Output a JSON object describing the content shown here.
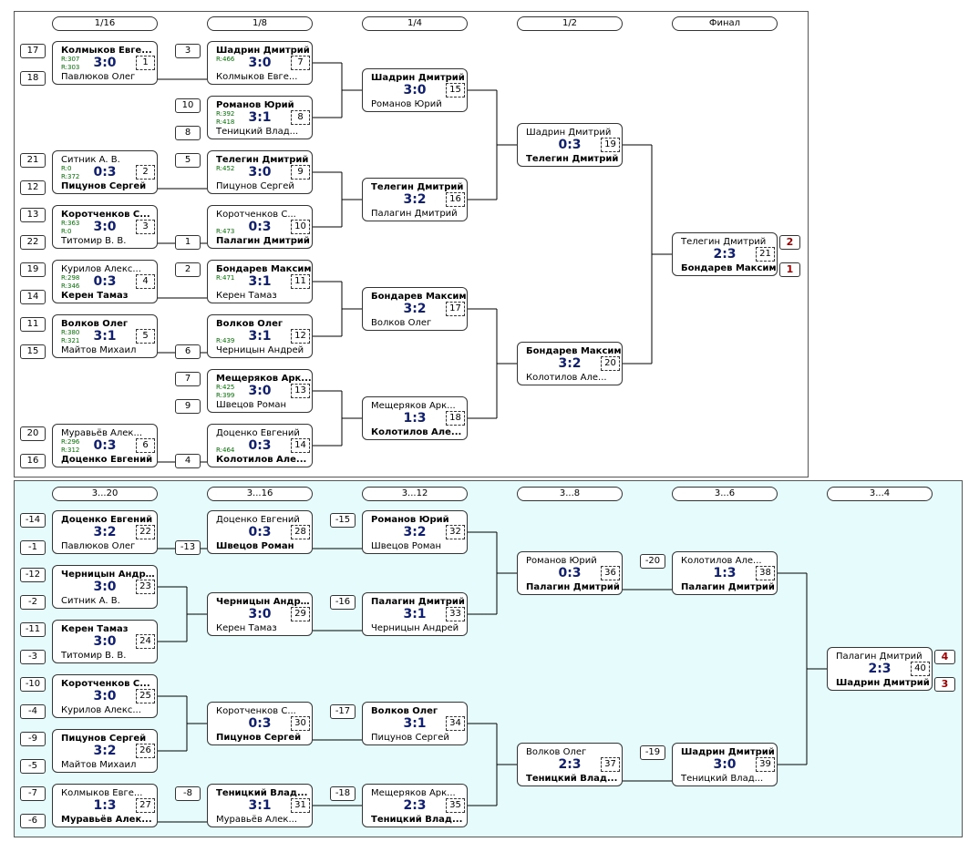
{
  "main": {
    "rounds": [
      "1/16",
      "1/8",
      "1/4",
      "1/2",
      "Финал"
    ],
    "matches": [
      {
        "id": "m1",
        "top": "Колмыков Евге...",
        "bot": "Павлюков Олег",
        "score": "3:0",
        "num": "1",
        "win": "top",
        "r1": "R:307",
        "r2": "R:303"
      },
      {
        "id": "m2",
        "top": "Ситник А. В.",
        "bot": "Пицунов Сергей",
        "score": "0:3",
        "num": "2",
        "win": "bot",
        "r1": "R:0",
        "r2": "R:372"
      },
      {
        "id": "m3",
        "top": "Коротченков С...",
        "bot": "Титомир В. В.",
        "score": "3:0",
        "num": "3",
        "win": "top",
        "r1": "R:363",
        "r2": "R:0"
      },
      {
        "id": "m4",
        "top": "Курилов Алекс...",
        "bot": "Керен Тамаз",
        "score": "0:3",
        "num": "4",
        "win": "bot",
        "r1": "R:298",
        "r2": "R:346"
      },
      {
        "id": "m5",
        "top": "Волков Олег",
        "bot": "Майтов Михаил",
        "score": "3:1",
        "num": "5",
        "win": "top",
        "r1": "R:380",
        "r2": "R:321"
      },
      {
        "id": "m6",
        "top": "Муравьёв Алек...",
        "bot": "Доценко Евгений",
        "score": "0:3",
        "num": "6",
        "win": "bot",
        "r1": "R:296",
        "r2": "R:312"
      },
      {
        "id": "m7",
        "top": "Шадрин Дмитрий",
        "bot": "Колмыков Евге...",
        "score": "3:0",
        "num": "7",
        "win": "top",
        "r1": "R:466",
        "r2": ""
      },
      {
        "id": "m8",
        "top": "Романов Юрий",
        "bot": "Теницкий Влад...",
        "score": "3:1",
        "num": "8",
        "win": "top",
        "r1": "R:392",
        "r2": "R:418"
      },
      {
        "id": "m9",
        "top": "Телегин Дмитрий",
        "bot": "Пицунов Сергей",
        "score": "3:0",
        "num": "9",
        "win": "top",
        "r1": "R:452",
        "r2": ""
      },
      {
        "id": "m10",
        "top": "Коротченков С...",
        "bot": "Палагин Дмитрий",
        "score": "0:3",
        "num": "10",
        "win": "bot",
        "r1": "",
        "r2": "R:473"
      },
      {
        "id": "m11",
        "top": "Бондарев Максим",
        "bot": "Керен Тамаз",
        "score": "3:1",
        "num": "11",
        "win": "top",
        "r1": "R:471",
        "r2": ""
      },
      {
        "id": "m12",
        "top": "Волков Олег",
        "bot": "Черницын Андрей",
        "score": "3:1",
        "num": "12",
        "win": "top",
        "r1": "",
        "r2": "R:439"
      },
      {
        "id": "m13",
        "top": "Мещеряков Арк...",
        "bot": "Швецов Роман",
        "score": "3:0",
        "num": "13",
        "win": "top",
        "r1": "R:425",
        "r2": "R:399"
      },
      {
        "id": "m14",
        "top": "Доценко Евгений",
        "bot": "Колотилов Але...",
        "score": "0:3",
        "num": "14",
        "win": "bot",
        "r1": "",
        "r2": "R:464"
      },
      {
        "id": "m15",
        "top": "Шадрин Дмитрий",
        "bot": "Романов Юрий",
        "score": "3:0",
        "num": "15",
        "win": "top",
        "r1": "",
        "r2": ""
      },
      {
        "id": "m16",
        "top": "Телегин Дмитрий",
        "bot": "Палагин Дмитрий",
        "score": "3:2",
        "num": "16",
        "win": "top",
        "r1": "",
        "r2": ""
      },
      {
        "id": "m17",
        "top": "Бондарев Максим",
        "bot": "Волков Олег",
        "score": "3:2",
        "num": "17",
        "win": "top",
        "r1": "",
        "r2": ""
      },
      {
        "id": "m18",
        "top": "Мещеряков Арк...",
        "bot": "Колотилов Але...",
        "score": "1:3",
        "num": "18",
        "win": "bot",
        "r1": "",
        "r2": ""
      },
      {
        "id": "m19",
        "top": "Шадрин Дмитрий",
        "bot": "Телегин Дмитрий",
        "score": "0:3",
        "num": "19",
        "win": "bot",
        "r1": "",
        "r2": ""
      },
      {
        "id": "m20",
        "top": "Бондарев Максим",
        "bot": "Колотилов Але...",
        "score": "3:2",
        "num": "20",
        "win": "top",
        "r1": "",
        "r2": ""
      },
      {
        "id": "m21",
        "top": "Телегин Дмитрий",
        "bot": "Бондарев Максим",
        "score": "2:3",
        "num": "21",
        "win": "bot",
        "r1": "",
        "r2": ""
      }
    ],
    "seeds": [
      "17",
      "18",
      "21",
      "12",
      "13",
      "22",
      "19",
      "14",
      "11",
      "15",
      "20",
      "16",
      "3",
      "10",
      "8",
      "5",
      "1",
      "2",
      "6",
      "7",
      "9",
      "4"
    ],
    "places": [
      "2",
      "1"
    ]
  },
  "consolation": {
    "rounds": [
      "3...20",
      "3...16",
      "3...12",
      "3...8",
      "3...6",
      "3...4"
    ],
    "matches": [
      {
        "id": "c22",
        "top": "Доценко Евгений",
        "bot": "Павлюков Олег",
        "score": "3:2",
        "num": "22",
        "win": "top"
      },
      {
        "id": "c23",
        "top": "Черницын Андрей",
        "bot": "Ситник А. В.",
        "score": "3:0",
        "num": "23",
        "win": "top"
      },
      {
        "id": "c24",
        "top": "Керен Тамаз",
        "bot": "Титомир В. В.",
        "score": "3:0",
        "num": "24",
        "win": "top"
      },
      {
        "id": "c25",
        "top": "Коротченков С...",
        "bot": "Курилов Алекс...",
        "score": "3:0",
        "num": "25",
        "win": "top"
      },
      {
        "id": "c26",
        "top": "Пицунов Сергей",
        "bot": "Майтов Михаил",
        "score": "3:2",
        "num": "26",
        "win": "top"
      },
      {
        "id": "c27",
        "top": "Колмыков Евге...",
        "bot": "Муравьёв Алек...",
        "score": "1:3",
        "num": "27",
        "win": "bot"
      },
      {
        "id": "c28",
        "top": "Доценко Евгений",
        "bot": "Швецов Роман",
        "score": "0:3",
        "num": "28",
        "win": "bot"
      },
      {
        "id": "c29",
        "top": "Черницын Андрей",
        "bot": "Керен Тамаз",
        "score": "3:0",
        "num": "29",
        "win": "top"
      },
      {
        "id": "c30",
        "top": "Коротченков С...",
        "bot": "Пицунов Сергей",
        "score": "0:3",
        "num": "30",
        "win": "bot"
      },
      {
        "id": "c31",
        "top": "Теницкий Влад...",
        "bot": "Муравьёв Алек...",
        "score": "3:1",
        "num": "31",
        "win": "top"
      },
      {
        "id": "c32",
        "top": "Романов Юрий",
        "bot": "Швецов Роман",
        "score": "3:2",
        "num": "32",
        "win": "top"
      },
      {
        "id": "c33",
        "top": "Палагин Дмитрий",
        "bot": "Черницын Андрей",
        "score": "3:1",
        "num": "33",
        "win": "top"
      },
      {
        "id": "c34",
        "top": "Волков Олег",
        "bot": "Пицунов Сергей",
        "score": "3:1",
        "num": "34",
        "win": "top"
      },
      {
        "id": "c35",
        "top": "Мещеряков Арк...",
        "bot": "Теницкий Влад...",
        "score": "2:3",
        "num": "35",
        "win": "bot"
      },
      {
        "id": "c36",
        "top": "Романов Юрий",
        "bot": "Палагин Дмитрий",
        "score": "0:3",
        "num": "36",
        "win": "bot"
      },
      {
        "id": "c37",
        "top": "Волков Олег",
        "bot": "Теницкий Влад...",
        "score": "2:3",
        "num": "37",
        "win": "bot"
      },
      {
        "id": "c38",
        "top": "Колотилов Але...",
        "bot": "Палагин Дмитрий",
        "score": "1:3",
        "num": "38",
        "win": "bot"
      },
      {
        "id": "c39",
        "top": "Шадрин Дмитрий",
        "bot": "Теницкий Влад...",
        "score": "3:0",
        "num": "39",
        "win": "top"
      },
      {
        "id": "c40",
        "top": "Палагин Дмитрий",
        "bot": "Шадрин Дмитрий",
        "score": "2:3",
        "num": "40",
        "win": "bot"
      }
    ],
    "seeds": [
      "-14",
      "-1",
      "-12",
      "-2",
      "-11",
      "-3",
      "-10",
      "-4",
      "-9",
      "-5",
      "-7",
      "-6",
      "-13",
      "-8",
      "-15",
      "-16",
      "-17",
      "-18",
      "-20",
      "-19"
    ],
    "places": [
      "4",
      "3"
    ]
  },
  "colors": {
    "score": "#101f6e",
    "rating": "#007000",
    "place": "#a00000",
    "consolation_bg": "#e6fcfc"
  }
}
